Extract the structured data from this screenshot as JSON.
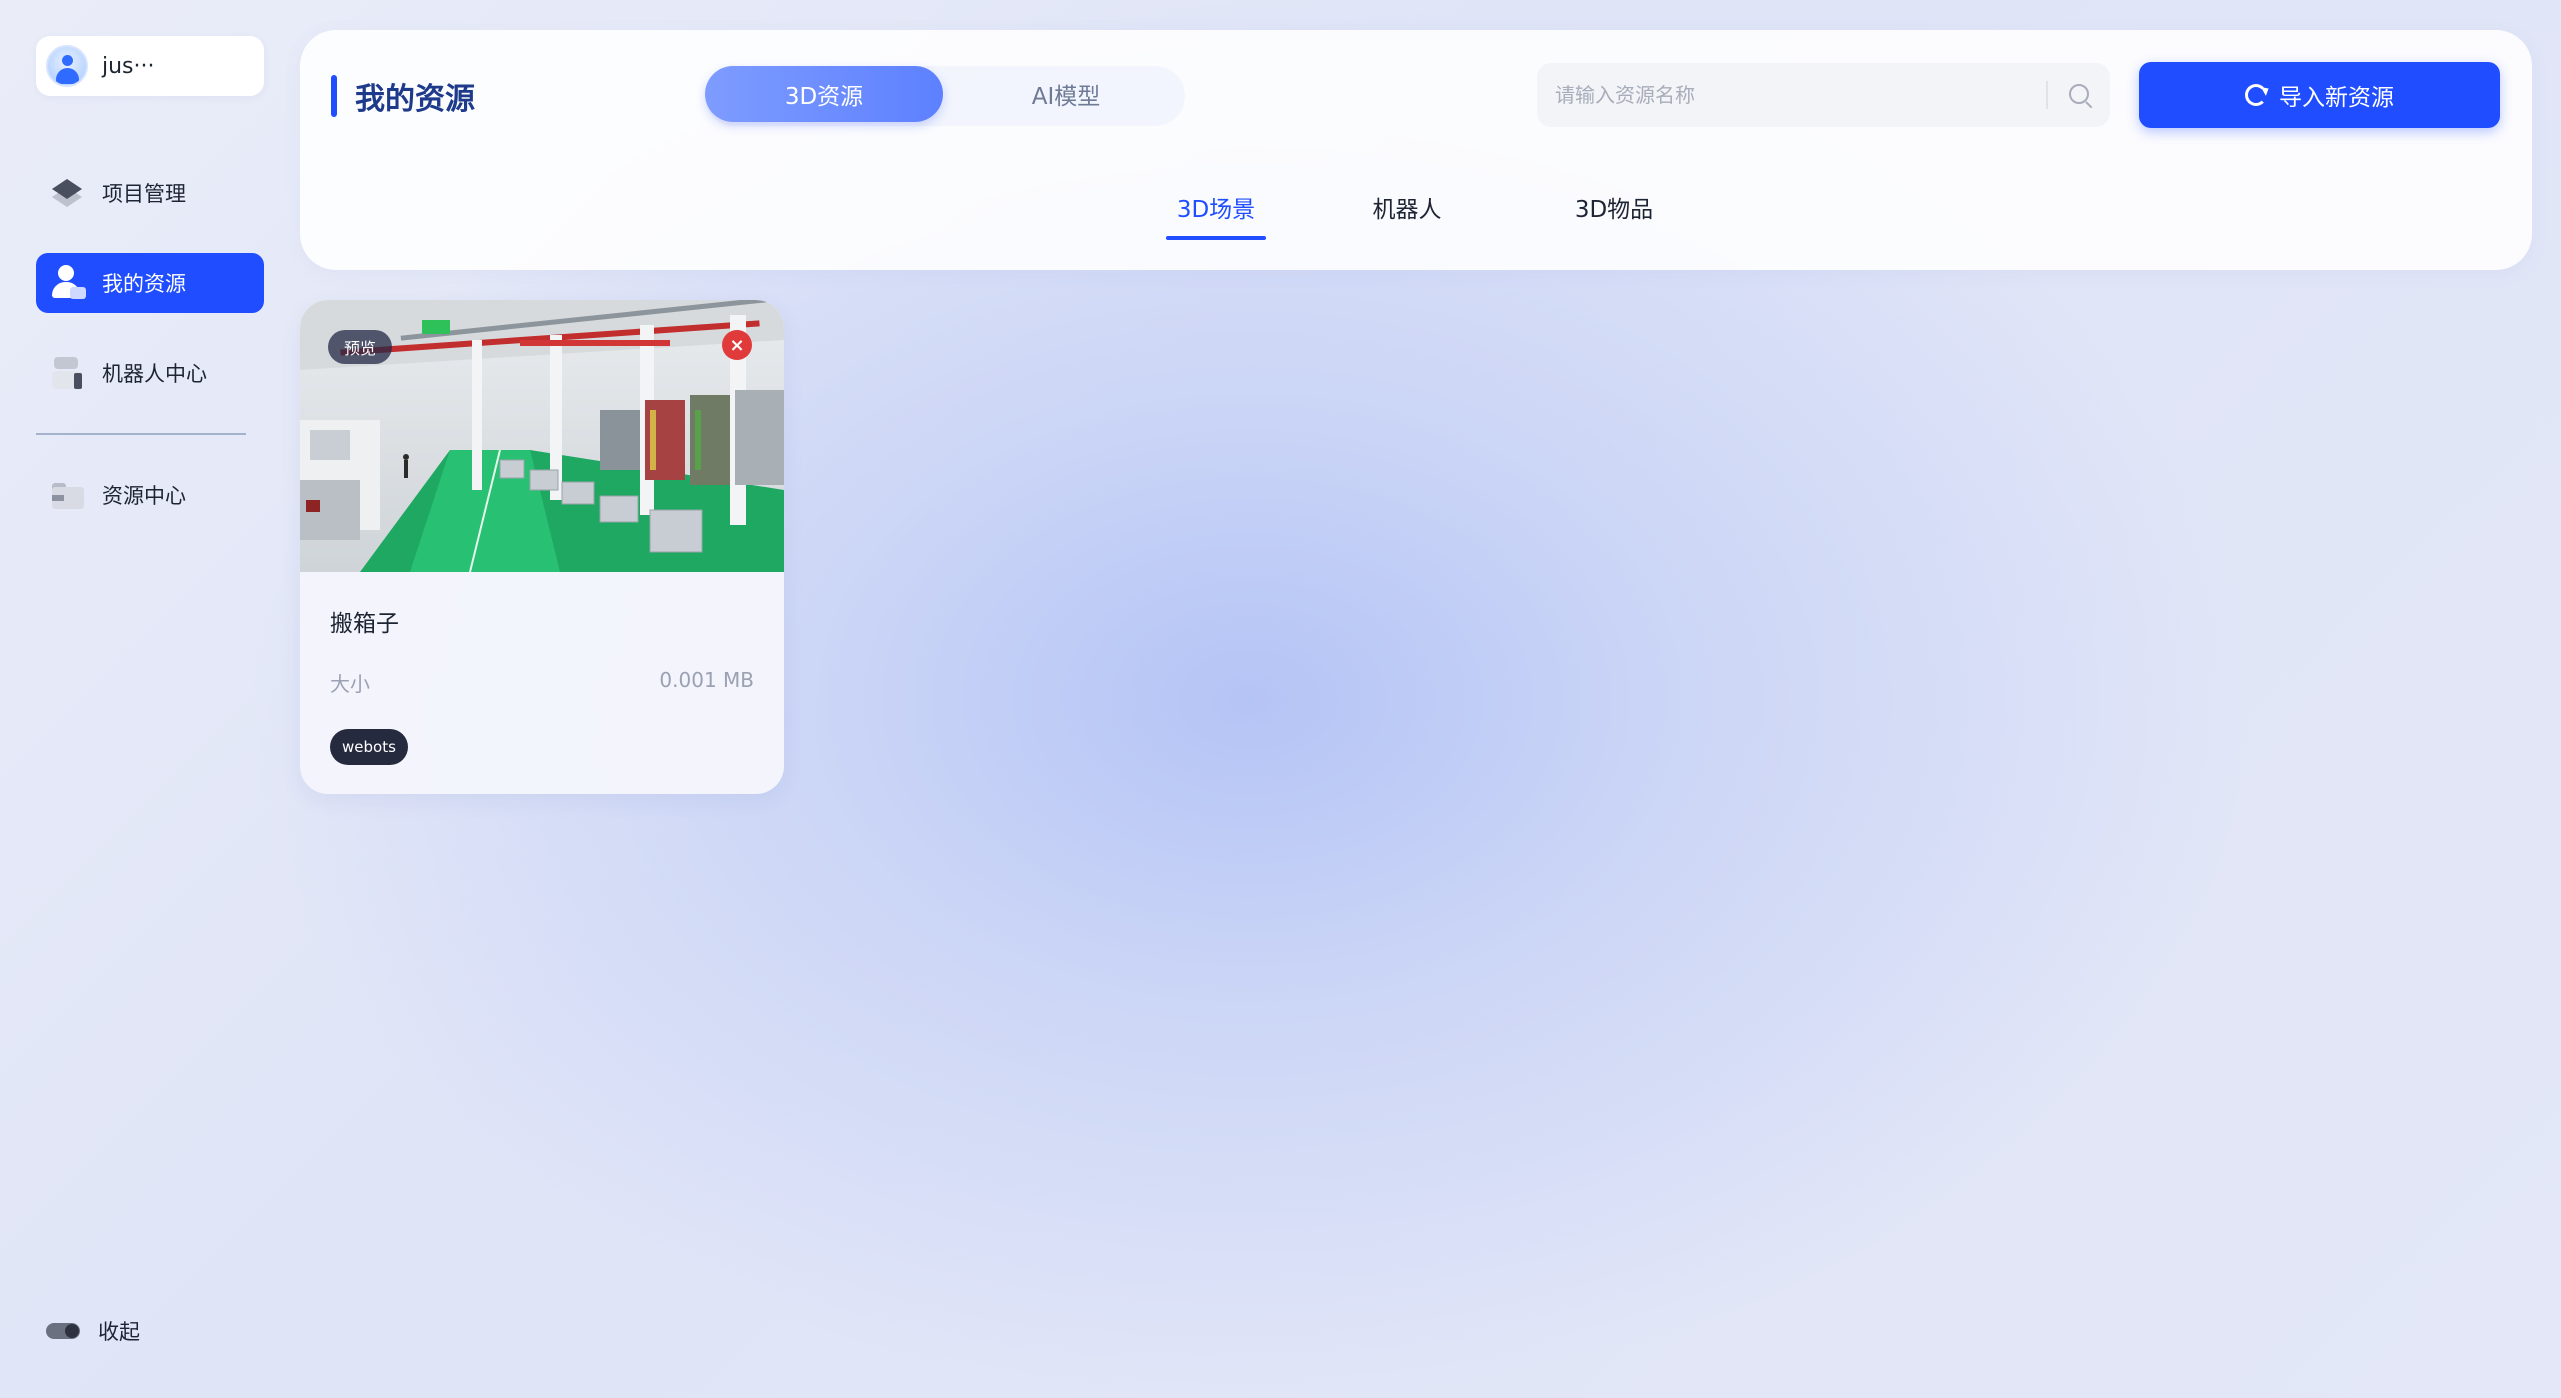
{
  "user": {
    "name": "jus···"
  },
  "sidebar": {
    "items": [
      {
        "label": "项目管理",
        "icon": "layers-icon",
        "active": false
      },
      {
        "label": "我的资源",
        "icon": "user-icon",
        "active": true
      },
      {
        "label": "机器人中心",
        "icon": "robot-icon",
        "active": false
      },
      {
        "label": "资源中心",
        "icon": "folder-icon",
        "active": false
      }
    ],
    "collapse_label": "收起"
  },
  "header": {
    "title": "我的资源",
    "type_tabs": [
      {
        "label": "3D资源",
        "active": true
      },
      {
        "label": "AI模型",
        "active": false
      }
    ],
    "search": {
      "placeholder": "请输入资源名称",
      "value": ""
    },
    "import_label": "导入新资源",
    "sub_tabs": [
      {
        "label": "3D场景",
        "active": true
      },
      {
        "label": "机器人",
        "active": false
      },
      {
        "label": "3D物品",
        "active": false
      }
    ]
  },
  "resources": [
    {
      "name": "搬箱子",
      "preview_label": "预览",
      "size_label": "大小",
      "size_value": "0.001 MB",
      "tag": "webots"
    }
  ],
  "colors": {
    "accent": "#1f4dff",
    "title": "#1e3a8a",
    "close": "#e03a3a",
    "tag_bg": "#252a3f"
  }
}
